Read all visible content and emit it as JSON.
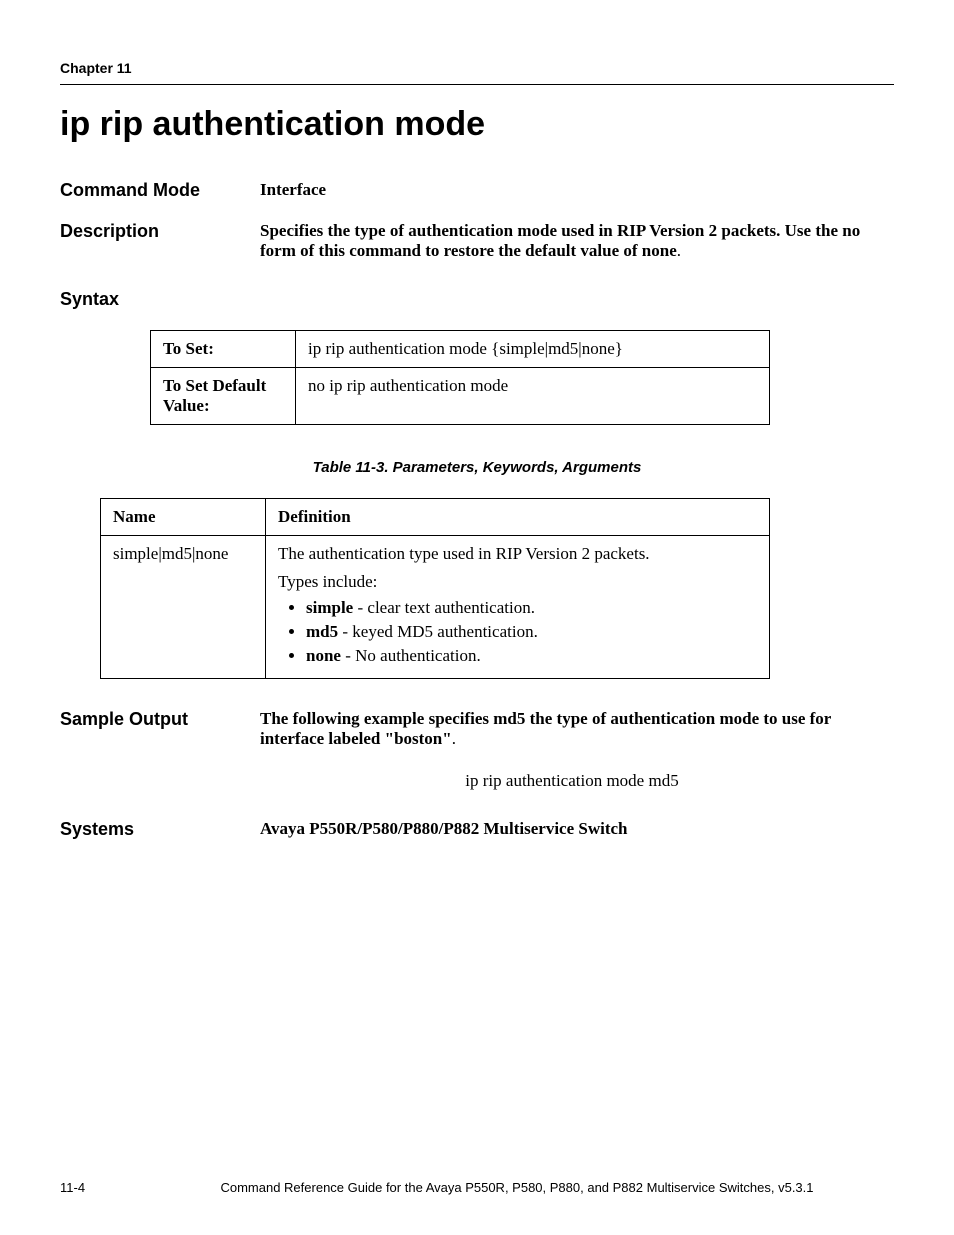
{
  "header": {
    "chapter": "Chapter 11"
  },
  "title": "ip rip authentication mode",
  "command_mode": {
    "label": "Command Mode",
    "value": "Interface"
  },
  "description": {
    "label": "Description",
    "value_bold": "Specifies the type of authentication mode used in RIP Version 2 packets. Use the no form of this command to restore the default value of none",
    "value_tail": "."
  },
  "syntax": {
    "heading": "Syntax",
    "rows": [
      {
        "key": "To Set:",
        "value": "ip rip authentication mode {simple|md5|none}"
      },
      {
        "key": "To Set Default Value:",
        "value": "no ip rip authentication mode"
      }
    ]
  },
  "param_table": {
    "caption": "Table 11-3.  Parameters, Keywords, Arguments",
    "headers": {
      "name": "Name",
      "definition": "Definition"
    },
    "row": {
      "name": "simple|md5|none",
      "def_line1": "The authentication type used in RIP Version 2 packets.",
      "def_line2": "Types include:",
      "items": [
        {
          "term": "simple",
          "rest": " - clear text authentication."
        },
        {
          "term": "md5",
          "rest": " - keyed MD5 authentication."
        },
        {
          "term": "none",
          "rest": " - No authentication."
        }
      ]
    }
  },
  "sample_output": {
    "label": "Sample Output",
    "text_bold": "The following example specifies md5 the type of authentication mode to use for interface labeled \"boston\"",
    "text_tail": ".",
    "code": "ip rip authentication mode md5"
  },
  "systems": {
    "label": "Systems",
    "value": "Avaya P550R/P580/P880/P882 Multiservice Switch"
  },
  "footer": {
    "page": "11-4",
    "text": "Command Reference Guide for the Avaya P550R, P580, P880, and P882 Multiservice Switches, v5.3.1"
  }
}
